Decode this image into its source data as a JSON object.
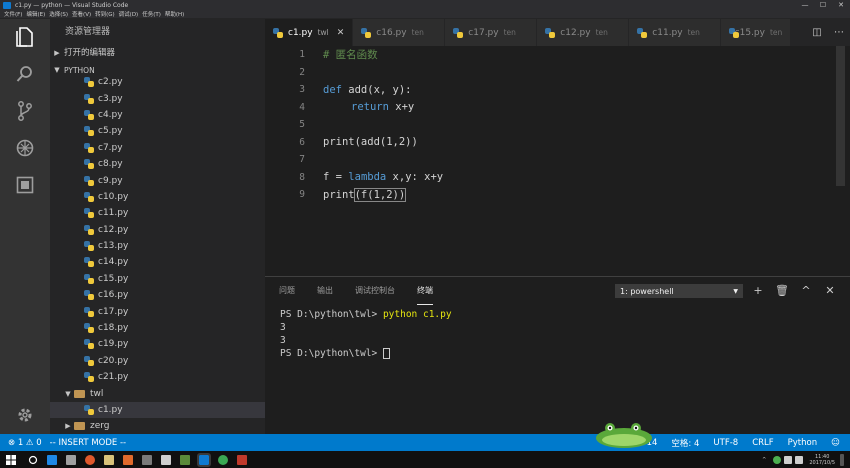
{
  "window": {
    "title": "c1.py — python — Visual Studio Code",
    "controls": [
      "—",
      "☐",
      "✕"
    ]
  },
  "menu": [
    "文件(F)",
    "编辑(E)",
    "选择(S)",
    "查看(V)",
    "转到(G)",
    "调试(D)",
    "任务(T)",
    "帮助(H)"
  ],
  "sidebar": {
    "title": "资源管理器",
    "open_editors": "打开的编辑器",
    "project": "PYTHON",
    "files": [
      "c2.py",
      "c3.py",
      "c4.py",
      "c5.py",
      "c7.py",
      "c8.py",
      "c9.py",
      "c10.py",
      "c11.py",
      "c12.py",
      "c13.py",
      "c14.py",
      "c15.py",
      "c16.py",
      "c17.py",
      "c18.py",
      "c19.py",
      "c20.py",
      "c21.py"
    ],
    "folder_twl": "twl",
    "twl_file": "c1.py",
    "folder_zerg": "zerg"
  },
  "tabs": [
    {
      "name": "c1.py",
      "desc": "twl",
      "active": true
    },
    {
      "name": "c16.py",
      "desc": "ten",
      "active": false
    },
    {
      "name": "c17.py",
      "desc": "ten",
      "active": false
    },
    {
      "name": "c12.py",
      "desc": "ten",
      "active": false
    },
    {
      "name": "c11.py",
      "desc": "ten",
      "active": false
    },
    {
      "name": "c15.py",
      "desc": "ten",
      "active": false
    }
  ],
  "editor": {
    "line_numbers": [
      "1",
      "2",
      "3",
      "4",
      "5",
      "6",
      "7",
      "8",
      "9"
    ],
    "code": {
      "l1": "# 匿名函数",
      "l3_kw": "def",
      "l3_rest": " add(x, y):",
      "l4_kw": "return",
      "l4_rest": " x+y",
      "l6": "print(add(1,2))",
      "l8_a": "f = ",
      "l8_kw": "lambda",
      "l8_rest": " x,y: x+y",
      "l9_a": "print",
      "l9_b": "(f(1,2))"
    }
  },
  "panel": {
    "tabs": [
      "问题",
      "输出",
      "调试控制台",
      "终端"
    ],
    "active_tab": "终端",
    "terminal_select": "1: powershell",
    "actions": [
      "+",
      "🗑",
      "^",
      "✕"
    ],
    "terminal": {
      "prompt1": "PS D:\\python\\twl> ",
      "cmd1": "python c1.py",
      "out1": "3",
      "out2": "3",
      "prompt2": "PS D:\\python\\twl> "
    }
  },
  "statusbar": {
    "errors": "⊗ 1 ⚠ 0",
    "mode": "-- INSERT MODE --",
    "line_col": "14",
    "spaces": "空格: 4",
    "encoding": "UTF-8",
    "eol": "CRLF",
    "language": "Python",
    "feedback": "☺"
  },
  "taskbar": {
    "time": "11:40",
    "date": "2017/10/5"
  },
  "colors": {
    "accent": "#007acc",
    "keyword": "#569cd6",
    "comment": "#608b4e",
    "terminal_command": "#e5e510"
  }
}
